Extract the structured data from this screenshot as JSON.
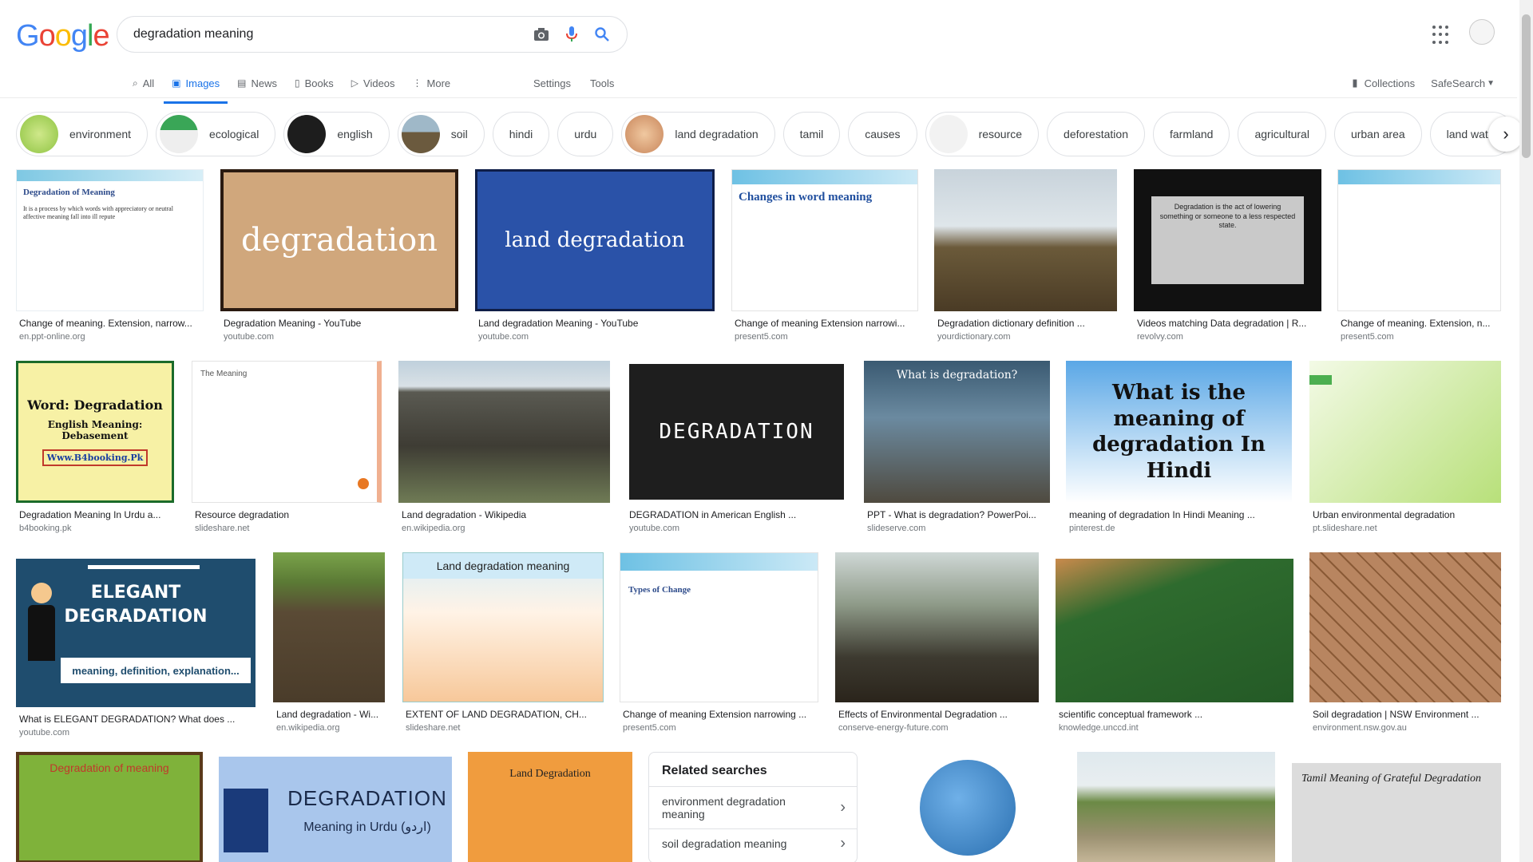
{
  "logo": {
    "text": "Google"
  },
  "search": {
    "query": "degradation meaning"
  },
  "tabs": [
    {
      "label": "All",
      "icon": "search-icon"
    },
    {
      "label": "Images",
      "icon": "image-icon"
    },
    {
      "label": "News",
      "icon": "news-icon"
    },
    {
      "label": "Books",
      "icon": "book-icon"
    },
    {
      "label": "Videos",
      "icon": "video-icon"
    },
    {
      "label": "More",
      "icon": "more-vert-icon"
    }
  ],
  "tools": {
    "settings": "Settings",
    "tools": "Tools"
  },
  "right_tools": {
    "collections": "Collections",
    "safesearch": "SafeSearch"
  },
  "chips": [
    "environment",
    "ecological",
    "english",
    "soil",
    "hindi",
    "urdu",
    "land degradation",
    "tamil",
    "causes",
    "resource",
    "deforestation",
    "farmland",
    "agricultural",
    "urban area",
    "land water"
  ],
  "results": [
    {
      "caption": "Change of meaning. Extension, narrow...",
      "source": "en.ppt-online.org",
      "image_title": "Degradation of Meaning",
      "image_text": "It is a process by which words with appreciatory or neutral affective meaning fall into ill repute"
    },
    {
      "caption": "Degradation Meaning - YouTube",
      "source": "youtube.com",
      "image_title": "degradation"
    },
    {
      "caption": "Land degradation Meaning - YouTube",
      "source": "youtube.com",
      "image_title": "land degradation"
    },
    {
      "caption": "Change of meaning Extension narrowi...",
      "source": "present5.com",
      "image_title": "Changes in word meaning"
    },
    {
      "caption": "Degradation dictionary definition ...",
      "source": "yourdictionary.com"
    },
    {
      "caption": "Videos matching Data degradation | R...",
      "source": "revolvy.com",
      "image_text": "Degradation is the act of lowering something or someone to a less respected state."
    },
    {
      "caption": "Change of meaning. Extension, n...",
      "source": "present5.com"
    },
    {
      "caption": "Degradation Meaning In Urdu a...",
      "source": "b4booking.pk",
      "image_title": "Word: Degradation",
      "image_text": "English Meaning: Debasement",
      "image_extra": "Www.B4booking.Pk"
    },
    {
      "caption": "Resource degradation",
      "source": "slideshare.net",
      "image_title": "The Meaning"
    },
    {
      "caption": "Land degradation - Wikipedia",
      "source": "en.wikipedia.org"
    },
    {
      "caption": "DEGRADATION in American English ...",
      "source": "youtube.com",
      "image_title": "DEGRADATION"
    },
    {
      "caption": "PPT - What is degradation? PowerPoi...",
      "source": "slideserve.com",
      "image_title": "What is degradation?"
    },
    {
      "caption": "meaning of degradation In Hindi Meaning ...",
      "source": "pinterest.de",
      "image_title": "What is the meaning of degradation In Hindi"
    },
    {
      "caption": "Urban environmental degradation",
      "source": "pt.slideshare.net"
    },
    {
      "caption": "What is ELEGANT DEGRADATION? What does ...",
      "source": "youtube.com",
      "image_title": "ELEGANT DEGRADATION",
      "image_text": "meaning, definition, explanation..."
    },
    {
      "caption": "Land degradation - Wi...",
      "source": "en.wikipedia.org"
    },
    {
      "caption": "EXTENT OF LAND DEGRADATION, CH...",
      "source": "slideshare.net",
      "image_title": "Land degradation meaning"
    },
    {
      "caption": "Change of meaning Extension narrowing ...",
      "source": "present5.com",
      "image_title": "Types of Change"
    },
    {
      "caption": "Effects of Environmental Degradation ...",
      "source": "conserve-energy-future.com"
    },
    {
      "caption": "scientific conceptual framework ...",
      "source": "knowledge.unccd.int"
    },
    {
      "caption": "Soil degradation | NSW Environment ...",
      "source": "environment.nsw.gov.au"
    },
    {
      "image_title": "Degradation of meaning"
    },
    {
      "image_title": "DEGRADATION",
      "image_text": "Meaning in Urdu (اردو)"
    },
    {
      "image_title": "Land Degradation"
    },
    {},
    {},
    {
      "image_title": "Tamil Meaning of Grateful Degradation"
    }
  ],
  "related": {
    "title": "Related searches",
    "items": [
      "environment degradation meaning",
      "soil degradation meaning"
    ]
  },
  "colors": {
    "accent": "#1a73e8",
    "g_blue": "#4285F4",
    "g_red": "#EA4335",
    "g_yellow": "#FBBC05",
    "g_green": "#34A853"
  }
}
